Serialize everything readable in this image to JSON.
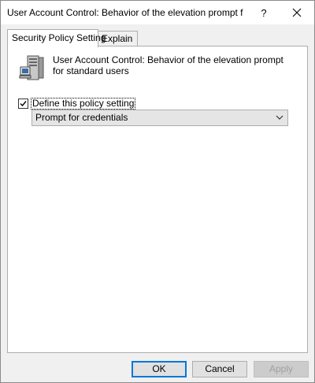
{
  "window": {
    "title": "User Account Control: Behavior of the elevation prompt f...",
    "help_label": "?",
    "close_label": "✕"
  },
  "tabs": [
    {
      "label": "Security Policy Setting",
      "active": true
    },
    {
      "label": "Explain",
      "active": false
    }
  ],
  "policy": {
    "icon": "server-computer-icon",
    "title": "User Account Control: Behavior of the elevation prompt for standard users"
  },
  "define_setting": {
    "label": "Define this policy setting",
    "checked": true
  },
  "dropdown": {
    "selected": "Prompt for credentials"
  },
  "buttons": {
    "ok": "OK",
    "cancel": "Cancel",
    "apply": "Apply"
  },
  "colors": {
    "accent": "#0078d7",
    "panel_bg": "#ffffff",
    "window_bg": "#f0f0f0"
  }
}
